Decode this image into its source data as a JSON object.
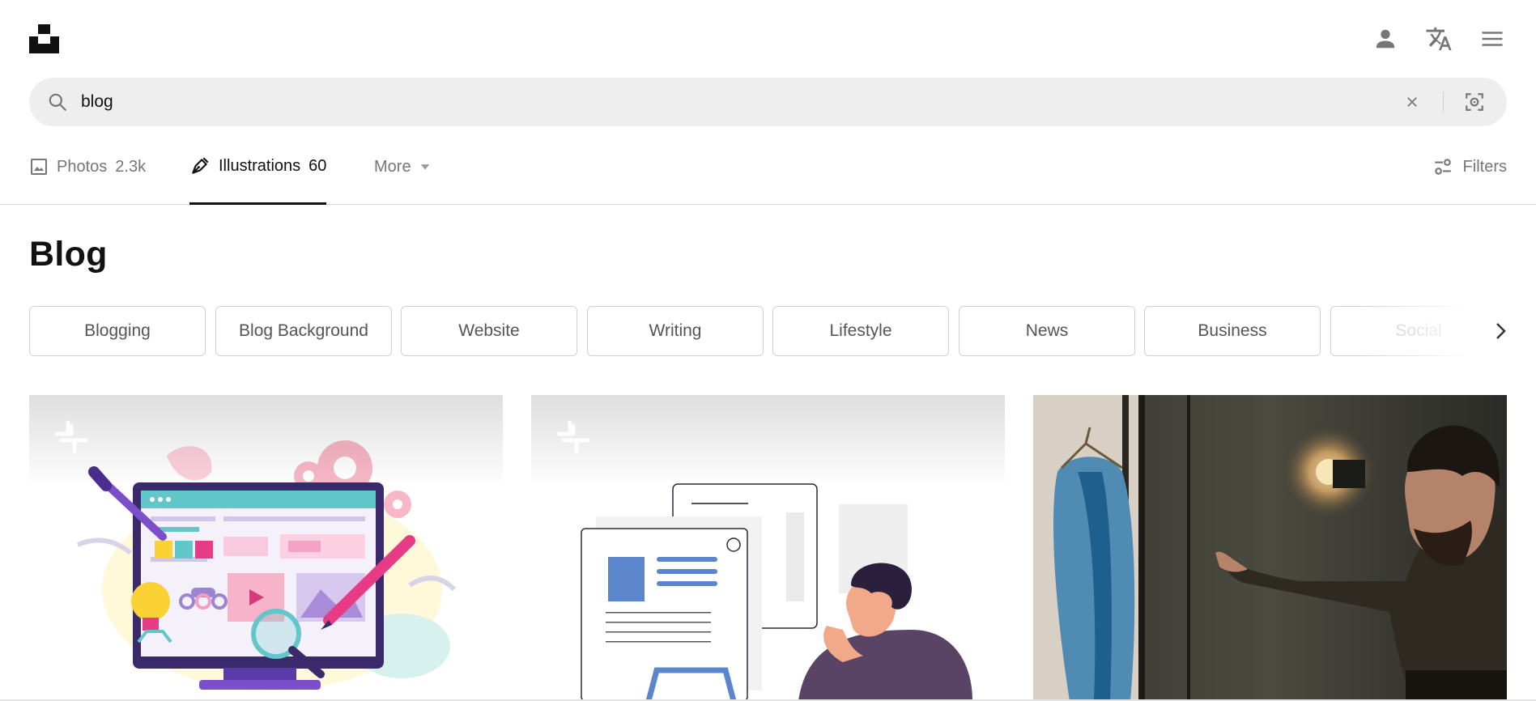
{
  "header": {
    "icons": {
      "logo": "unsplash-logo",
      "account": "person-icon",
      "language": "translate-icon",
      "menu": "hamburger-menu-icon"
    }
  },
  "search": {
    "value": "blog",
    "placeholder": "",
    "icons": {
      "search": "search-icon",
      "clear": "close-icon",
      "visual": "visual-search-icon"
    }
  },
  "tabs": [
    {
      "label": "Photos",
      "count": "2.3k",
      "icon": "image-icon",
      "active": false
    },
    {
      "label": "Illustrations",
      "count": "60",
      "icon": "pen-nib-icon",
      "active": true
    },
    {
      "label": "More",
      "count": "",
      "icon": "caret-down-icon",
      "active": false
    }
  ],
  "filters": {
    "label": "Filters",
    "icon": "sliders-icon"
  },
  "page": {
    "title": "Blog"
  },
  "related_chips": [
    "Blogging",
    "Blog Background",
    "Website",
    "Writing",
    "Lifestyle",
    "News",
    "Business",
    "Social"
  ],
  "results": [
    {
      "kind": "illustration",
      "subject": "monitor with web layout, paintbrush and pencil"
    },
    {
      "kind": "illustration",
      "subject": "person thinking in front of documents"
    },
    {
      "kind": "photo",
      "subject": "man pointing at clothing on a rack in studio"
    }
  ],
  "colors": {
    "accent": "#111111",
    "muted_text": "#767676",
    "search_bg": "#eeeeee",
    "border": "#d1d1d1"
  }
}
